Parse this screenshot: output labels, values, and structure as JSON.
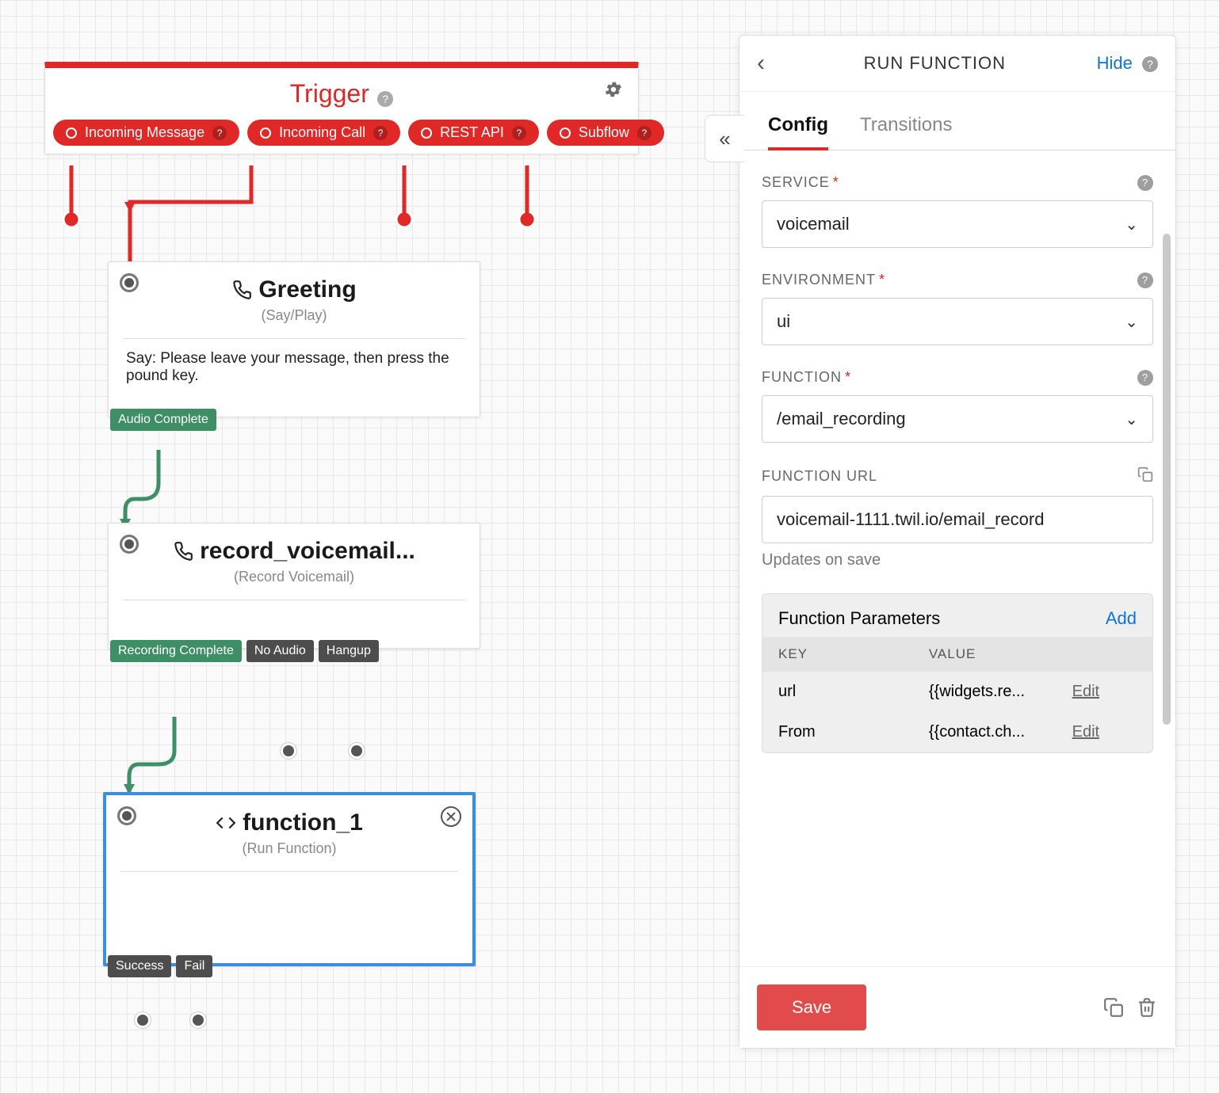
{
  "trigger": {
    "title": "Trigger",
    "pills": [
      "Incoming Message",
      "Incoming Call",
      "REST API",
      "Subflow"
    ]
  },
  "nodes": {
    "greeting": {
      "title": "Greeting",
      "sub": "(Say/Play)",
      "body": "Say: Please leave your message, then press the pound key.",
      "badges": [
        "Audio Complete"
      ]
    },
    "record": {
      "title": "record_voicemail...",
      "sub": "(Record Voicemail)",
      "body": "",
      "badges": [
        "Recording Complete",
        "No Audio",
        "Hangup"
      ]
    },
    "function1": {
      "title": "function_1",
      "sub": "(Run Function)",
      "body": "",
      "badges": [
        "Success",
        "Fail"
      ]
    }
  },
  "panel": {
    "title": "RUN FUNCTION",
    "hide": "Hide",
    "tabs": {
      "config": "Config",
      "transitions": "Transitions"
    },
    "fields": {
      "service_label": "SERVICE",
      "service_value": "voicemail",
      "env_label": "ENVIRONMENT",
      "env_value": "ui",
      "func_label": "FUNCTION",
      "func_value": "/email_recording",
      "funcurl_label": "FUNCTION URL",
      "funcurl_value": "voicemail-1111.twil.io/email_record",
      "funcurl_hint": "Updates on save"
    },
    "params": {
      "title": "Function Parameters",
      "add": "Add",
      "col_key": "KEY",
      "col_val": "VALUE",
      "rows": [
        {
          "key": "url",
          "value": "{{widgets.re...",
          "action": "Edit"
        },
        {
          "key": "From",
          "value": "{{contact.ch...",
          "action": "Edit"
        }
      ]
    },
    "save": "Save"
  }
}
